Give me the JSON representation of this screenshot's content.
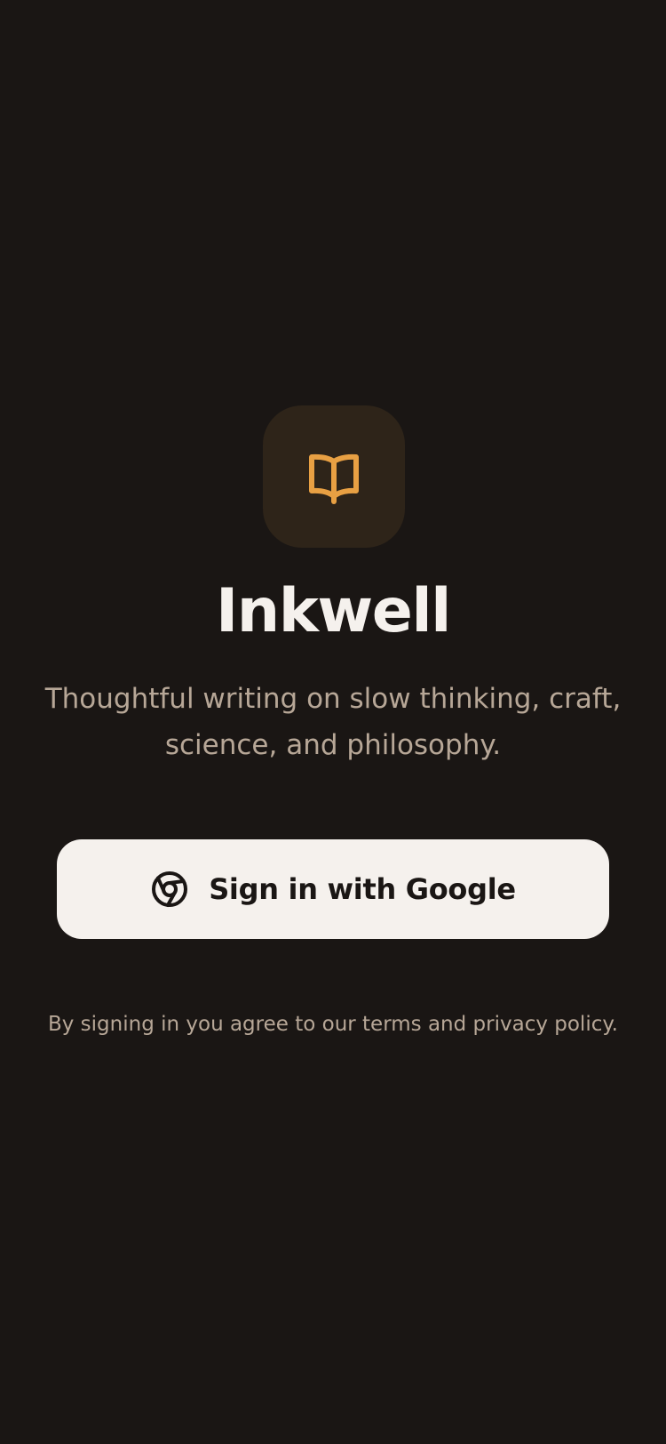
{
  "app": {
    "title": "Inkwell",
    "tagline": "Thoughtful writing on slow thinking, craft, science, and philosophy."
  },
  "logo": {
    "icon": "open-book-icon"
  },
  "auth": {
    "button_label": "Sign in with Google",
    "button_icon": "chrome-icon"
  },
  "legal": {
    "text": "By signing in you agree to our terms and privacy policy."
  },
  "colors": {
    "background": "#1a1614",
    "tile": "#2e2419",
    "accent": "#e8a043",
    "title": "#f5f1ed",
    "muted": "#b7a797",
    "button_bg": "#f5f1ed",
    "button_text": "#1a1614"
  }
}
